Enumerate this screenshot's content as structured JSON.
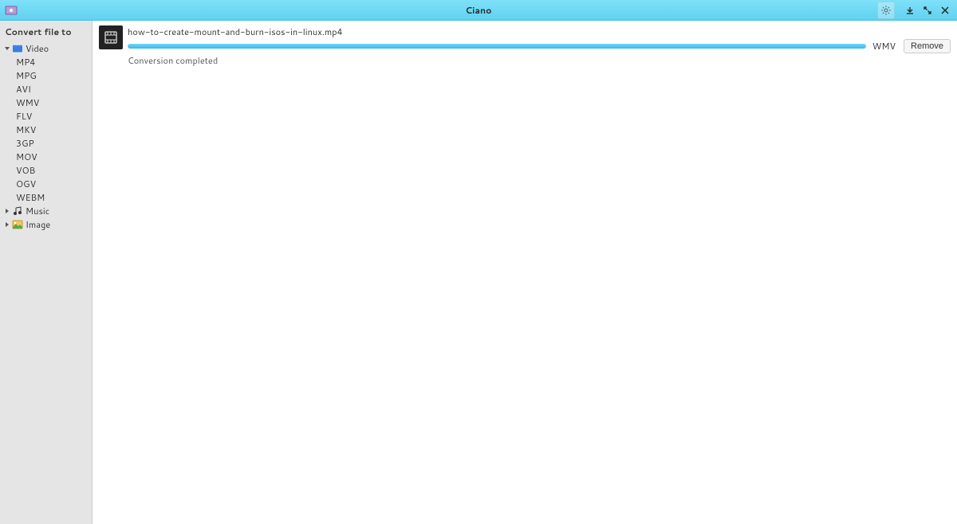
{
  "app": {
    "title": "Ciano"
  },
  "titlebar": {
    "settings_tooltip": "Settings"
  },
  "sidebar": {
    "header": "Convert file to",
    "categories": [
      {
        "id": "video",
        "label": "Video",
        "expanded": true,
        "children": [
          "MP4",
          "MPG",
          "AVI",
          "WMV",
          "FLV",
          "MKV",
          "3GP",
          "MOV",
          "VOB",
          "OGV",
          "WEBM"
        ]
      },
      {
        "id": "music",
        "label": "Music",
        "expanded": false,
        "children": []
      },
      {
        "id": "image",
        "label": "Image",
        "expanded": false,
        "children": []
      }
    ]
  },
  "jobs": [
    {
      "file": "how-to-create-mount-and-burn-isos-in-linux.mp4",
      "status": "Conversion completed",
      "target_format": "WMV",
      "remove_label": "Remove",
      "progress_pct": 100
    }
  ]
}
